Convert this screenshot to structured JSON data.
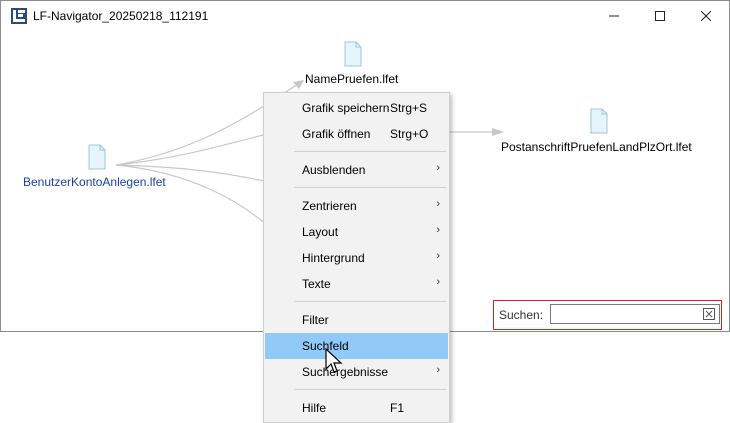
{
  "window": {
    "title": "LF-Navigator_20250218_112191"
  },
  "nodes": {
    "center": "NamePruefen.lfet",
    "right": "PostanschriftPruefenLandPlzOrt.lfet",
    "left": "BenutzerKontoAnlegen.lfet"
  },
  "search": {
    "label": "Suchen:",
    "value": ""
  },
  "menu": {
    "grafik_speichern": {
      "label": "Grafik speichern",
      "shortcut": "Strg+S"
    },
    "grafik_oeffnen": {
      "label": "Grafik öffnen",
      "shortcut": "Strg+O"
    },
    "ausblenden": {
      "label": "Ausblenden"
    },
    "zentrieren": {
      "label": "Zentrieren"
    },
    "layout": {
      "label": "Layout"
    },
    "hintergrund": {
      "label": "Hintergrund"
    },
    "texte": {
      "label": "Texte"
    },
    "filter": {
      "label": "Filter"
    },
    "suchfeld": {
      "label": "Suchfeld"
    },
    "suchergebnisse": {
      "label": "Suchergebnisse"
    },
    "hilfe": {
      "label": "Hilfe",
      "shortcut": "F1"
    }
  },
  "colors": {
    "highlight": "#91c9f7",
    "selected_text": "#1a3fa8",
    "search_border": "#d32020"
  }
}
